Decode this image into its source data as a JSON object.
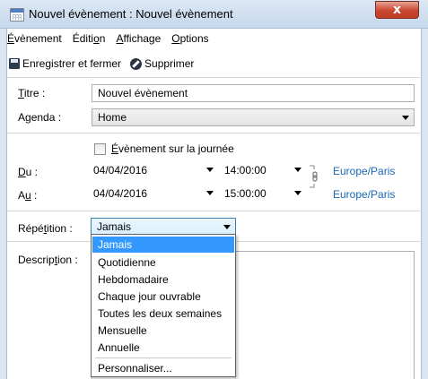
{
  "window": {
    "title": "Nouvel évènement : Nouvel évènement",
    "close_label": "x"
  },
  "menu": {
    "items": [
      {
        "pre": "",
        "u": "É",
        "post": "vènement"
      },
      {
        "pre": "Éditi",
        "u": "o",
        "post": "n"
      },
      {
        "pre": "",
        "u": "A",
        "post": "ffichage"
      },
      {
        "pre": "",
        "u": "O",
        "post": "ptions"
      }
    ]
  },
  "toolbar": {
    "save_close": "Enregistrer et fermer",
    "delete": "Supprimer"
  },
  "form": {
    "title_label": {
      "u": "T",
      "post": "itre :"
    },
    "title_value": "Nouvel évènement",
    "agenda_label": {
      "pre": "A",
      "u": "g",
      "post": "enda :"
    },
    "agenda_value": "Home",
    "all_day_label": {
      "u": "É",
      "post": "vènement sur la journée"
    },
    "from_label": {
      "u": "D",
      "post": "u :"
    },
    "from_date": "04/04/2016",
    "from_time": "14:00:00",
    "to_label": {
      "pre": "A",
      "u": "u",
      "post": " :"
    },
    "to_date": "04/04/2016",
    "to_time": "15:00:00",
    "timezone_from": "Europe/Paris",
    "timezone_to": "Europe/Paris",
    "repeat_label": {
      "pre": "Répé",
      "u": "t",
      "post": "ition :"
    },
    "repeat_value": "Jamais",
    "description_label": {
      "pre": "Descrip",
      "u": "t",
      "post": "ion :"
    }
  },
  "repeat_options": [
    "Jamais",
    "Quotidienne",
    "Hebdomadaire",
    "Chaque jour ouvrable",
    "Toutes les deux semaines",
    "Mensuelle",
    "Annuelle",
    "Personnaliser..."
  ],
  "colors": {
    "accent": "#3399ff",
    "link": "#1a66b5"
  }
}
